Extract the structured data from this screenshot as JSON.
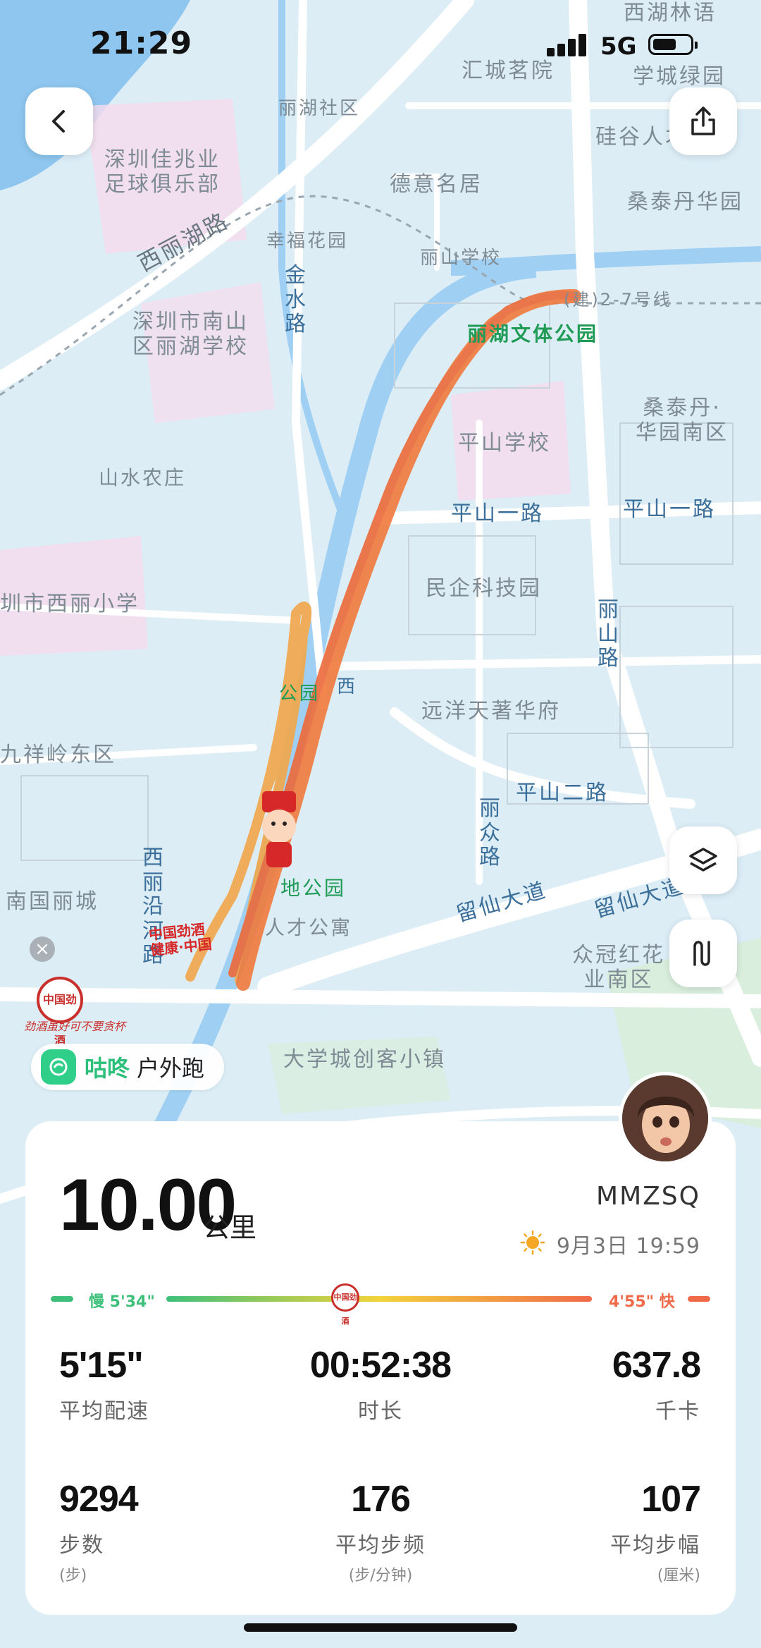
{
  "status_bar": {
    "time": "21:29",
    "network": "5G"
  },
  "map": {
    "labels": [
      {
        "id": "xihu",
        "text": "西湖林语"
      },
      {
        "id": "huicheng",
        "text": "汇城茗院"
      },
      {
        "id": "xuecheng",
        "text": "学城绿园"
      },
      {
        "id": "lihu",
        "text": "丽湖社区"
      },
      {
        "id": "guigu",
        "text": "硅谷人才公寓"
      },
      {
        "id": "club",
        "text": "深圳佳兆业\n足球俱乐部"
      },
      {
        "id": "deyi",
        "text": "德意名居"
      },
      {
        "id": "sangtai",
        "text": "桑泰丹华园"
      },
      {
        "id": "xingfu",
        "text": "幸福花园"
      },
      {
        "id": "lishan",
        "text": "丽山学校"
      },
      {
        "id": "jinshui",
        "text": "金\n水\n路"
      },
      {
        "id": "xilihu",
        "text": "西丽湖路"
      },
      {
        "id": "nanshan",
        "text": "深圳市南山\n区丽湖学校"
      },
      {
        "id": "wentipark",
        "text": "丽湖文体公园"
      },
      {
        "id": "line",
        "text": "(建)2-7号线"
      },
      {
        "id": "sangtainan",
        "text": "桑泰丹·\n华园南区"
      },
      {
        "id": "pingshansch",
        "text": "平山学校"
      },
      {
        "id": "shanshui",
        "text": "山水农庄"
      },
      {
        "id": "pingshan1a",
        "text": "平山一路"
      },
      {
        "id": "pingshan1b",
        "text": "平山一路"
      },
      {
        "id": "minqi",
        "text": "民企科技园"
      },
      {
        "id": "xili",
        "text": "圳市西丽小学"
      },
      {
        "id": "lishanlu",
        "text": "丽\n山\n路"
      },
      {
        "id": "yuanyang",
        "text": "远洋天著华府"
      },
      {
        "id": "jiuxiang",
        "text": "九祥岭东区"
      },
      {
        "id": "pingshan2",
        "text": "平山二路"
      },
      {
        "id": "lizhong",
        "text": "丽\n众\n路"
      },
      {
        "id": "xiliyan",
        "text": "西\n丽\n沿\n河\n路"
      },
      {
        "id": "nanguo",
        "text": "南国丽城"
      },
      {
        "id": "wetland",
        "text": "地公园"
      },
      {
        "id": "rencai",
        "text": "人才公寓"
      },
      {
        "id": "liuxian1",
        "text": "留仙大道"
      },
      {
        "id": "liuxian2",
        "text": "留仙大道"
      },
      {
        "id": "zhongguan",
        "text": "众冠红花\n业南区"
      },
      {
        "id": "chuangke",
        "text": "大学城创客小镇"
      },
      {
        "id": "gongyuan",
        "text": "公园"
      },
      {
        "id": "xiroad",
        "text": "西"
      }
    ],
    "sponsor": {
      "badge": "中国劲酒",
      "slogan": "劲酒虽好可不要贪杯",
      "route_banner": "中国劲酒\n健康·中国"
    }
  },
  "app_tag": {
    "brand": "咕咚",
    "activity": "户外跑"
  },
  "summary": {
    "distance": "10.00",
    "distance_unit": "公里",
    "username": "MMZSQ",
    "datetime": "9月3日 19:59",
    "pace_scale": {
      "slow": "慢 5'34\"",
      "fast": "4'55\" 快"
    },
    "stats": [
      {
        "id": "avg-pace",
        "value": "5'15\"",
        "label": "平均配速",
        "unit": ""
      },
      {
        "id": "duration",
        "value": "00:52:38",
        "label": "时长",
        "unit": ""
      },
      {
        "id": "calories",
        "value": "637.8",
        "label": "千卡",
        "unit": ""
      },
      {
        "id": "steps",
        "value": "9294",
        "label": "步数",
        "unit": "(步)"
      },
      {
        "id": "cadence",
        "value": "176",
        "label": "平均步频",
        "unit": "(步/分钟)"
      },
      {
        "id": "stride",
        "value": "107",
        "label": "平均步幅",
        "unit": "(厘米)"
      }
    ]
  },
  "colors": {
    "brand_green": "#2bbf7a",
    "route_orange": "#f07a3c",
    "slow": "#3fc07a",
    "fast": "#f06a4a"
  }
}
